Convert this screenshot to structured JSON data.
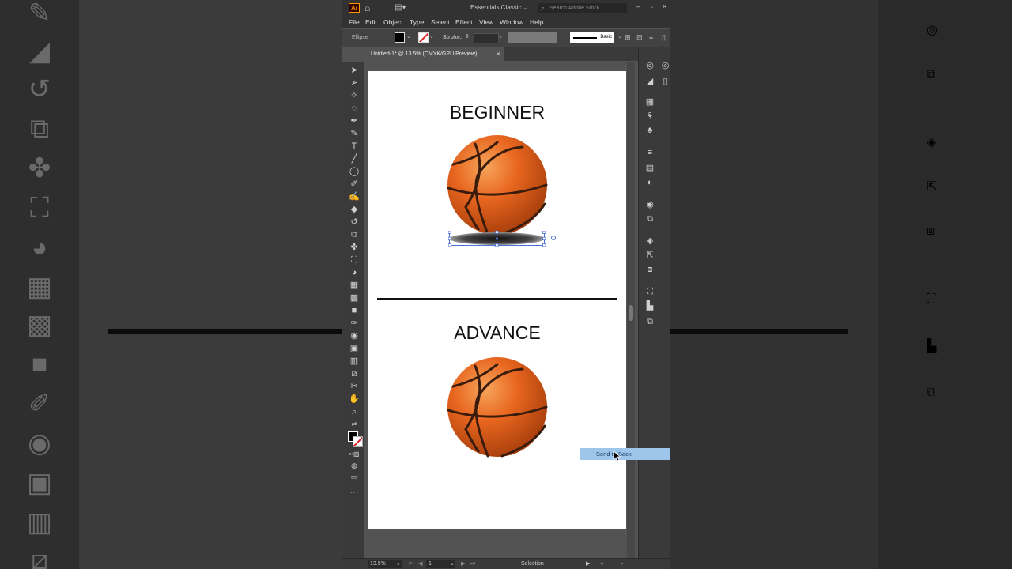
{
  "app": {
    "logo": "Ai",
    "workspace": "Essentials Classic",
    "search_placeholder": "Search Adobe Stock"
  },
  "menu": [
    "File",
    "Edit",
    "Object",
    "Type",
    "Select",
    "Effect",
    "View",
    "Window",
    "Help"
  ],
  "control_bar": {
    "selection_label": "Ellipse",
    "stroke_label": "Stroke:",
    "stroke_style_label": "Basic"
  },
  "document_tab": {
    "title": "Untitled-1* @ 13.5% (CMYK/GPU Preview)",
    "close_glyph": "×"
  },
  "artboard": {
    "top_heading": "BEGINNER",
    "bottom_heading": "ADVANCE"
  },
  "context_menu": {
    "item": "Send to Back"
  },
  "status_bar": {
    "zoom": "13.5%",
    "artboard_number": "1",
    "tool": "Selection"
  },
  "colors": {
    "ball_orange": "#e8661f",
    "ball_seams": "#3a1c0c",
    "selection_blue": "#4a6fd8",
    "menu_highlight": "#9ec6ea"
  }
}
